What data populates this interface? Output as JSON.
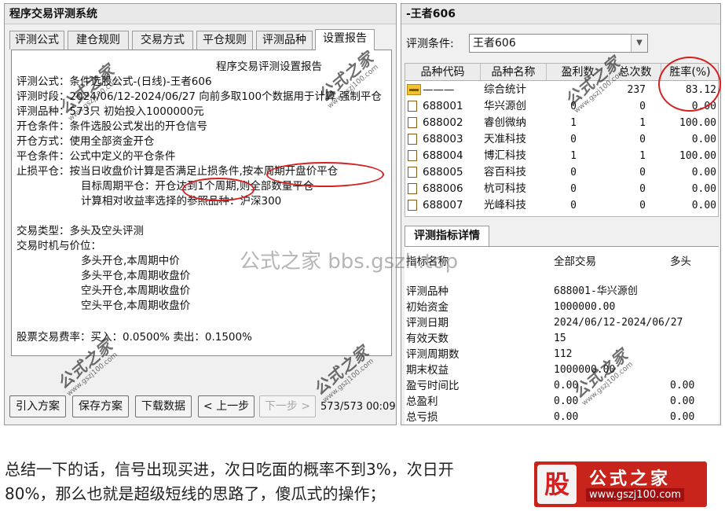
{
  "left": {
    "title": "程序交易评测系统",
    "tabs": [
      "评测公式",
      "建仓规则",
      "交易方式",
      "平仓规则",
      "评测品种",
      "设置报告"
    ],
    "report": {
      "heading": "程序交易评测设置报告",
      "lines": [
        "评测公式：条件选股公式-(日线)-王者606",
        "评测时段：2024/06/12-2024/06/27 向前多取100个数据用于计算 强制平仓",
        "评测品种：573只 初始投入1000000元",
        "开仓条件：条件选股公式发出的开仓信号",
        "开仓方式：使用全部资金开仓",
        "平仓条件：公式中定义的平仓条件",
        "止损平仓：按当日收盘价计算是否满足止损条件,按本周期开盘价平仓",
        "目标周期平仓：开仓达到1个周期,则全部数量平仓",
        "计算相对收益率选择的参照品种：沪深300",
        "交易类型：多头及空头评测",
        "交易时机与价位：",
        "多头开仓,本周期中价",
        "多头平仓,本周期收盘价",
        "空头开仓,本周期收盘价",
        "空头平仓,本周期收盘价",
        "股票交易费率：买入：0.0500%  卖出：0.1500%"
      ]
    },
    "buttons": {
      "import": "引入方案",
      "save": "保存方案",
      "download": "下载数据",
      "prev": "< 上一步",
      "next": "下一步 >"
    },
    "status": "573/573 00:09"
  },
  "right": {
    "title": "-王者606",
    "cond_label": "评测条件:",
    "cond_value": "王者606",
    "headers": [
      "品种代码",
      "品种名称",
      "盈利数",
      "总次数",
      "胜率(%)"
    ],
    "rows": [
      {
        "code": "———",
        "name": "综合统计",
        "win": "",
        "total": "237",
        "rate": "83.12",
        "icon": "folder-icon"
      },
      {
        "code": "688001",
        "name": "华兴源创",
        "win": "0",
        "total": "0",
        "rate": "0.00",
        "icon": "document-icon"
      },
      {
        "code": "688002",
        "name": "睿创微纳",
        "win": "1",
        "total": "1",
        "rate": "100.00",
        "icon": "document-icon"
      },
      {
        "code": "688003",
        "name": "天准科技",
        "win": "0",
        "total": "0",
        "rate": "0.00",
        "icon": "document-icon"
      },
      {
        "code": "688004",
        "name": "博汇科技",
        "win": "1",
        "total": "1",
        "rate": "100.00",
        "icon": "document-icon"
      },
      {
        "code": "688005",
        "name": "容百科技",
        "win": "0",
        "total": "0",
        "rate": "0.00",
        "icon": "document-icon"
      },
      {
        "code": "688006",
        "name": "杭可科技",
        "win": "0",
        "total": "0",
        "rate": "0.00",
        "icon": "document-icon"
      },
      {
        "code": "688007",
        "name": "光峰科技",
        "win": "0",
        "total": "0",
        "rate": "0.00",
        "icon": "document-icon"
      }
    ],
    "detail_tab": "评测指标详情",
    "detail_headers": [
      "指标名称",
      "全部交易",
      "多头"
    ],
    "details": [
      {
        "label": "评测品种",
        "all": "688001-华兴源创",
        "long": ""
      },
      {
        "label": "初始资金",
        "all": "1000000.00",
        "long": ""
      },
      {
        "label": "评测日期",
        "all": "2024/06/12-2024/06/27",
        "long": ""
      },
      {
        "label": "有效天数",
        "all": "15",
        "long": ""
      },
      {
        "label": "评测周期数",
        "all": "112",
        "long": ""
      },
      {
        "label": "期末权益",
        "all": "1000000.00",
        "long": ""
      },
      {
        "label": "盈亏时间比",
        "all": "0.00",
        "long": "0.00"
      },
      {
        "label": "总盈利",
        "all": "0.00",
        "long": "0.00"
      },
      {
        "label": "总亏损",
        "all": "0.00",
        "long": "0.00"
      }
    ]
  },
  "watermarks": {
    "brand": "公式之家",
    "url": "www.gszj100.com",
    "center": "公式之家 bbs.gszh.top"
  },
  "caption": {
    "line1": "总结一下的话，信号出现买进，次日吃面的概率不到3%，次日开",
    "line2": "80%，那么也就是超级短线的思路了，傻瓜式的操作；"
  },
  "logo": {
    "char": "股",
    "name": "公式之家",
    "url": "www.gszj100.com"
  },
  "colors": {
    "annotation": "#d42020",
    "logo_bg": "#c8241c"
  }
}
